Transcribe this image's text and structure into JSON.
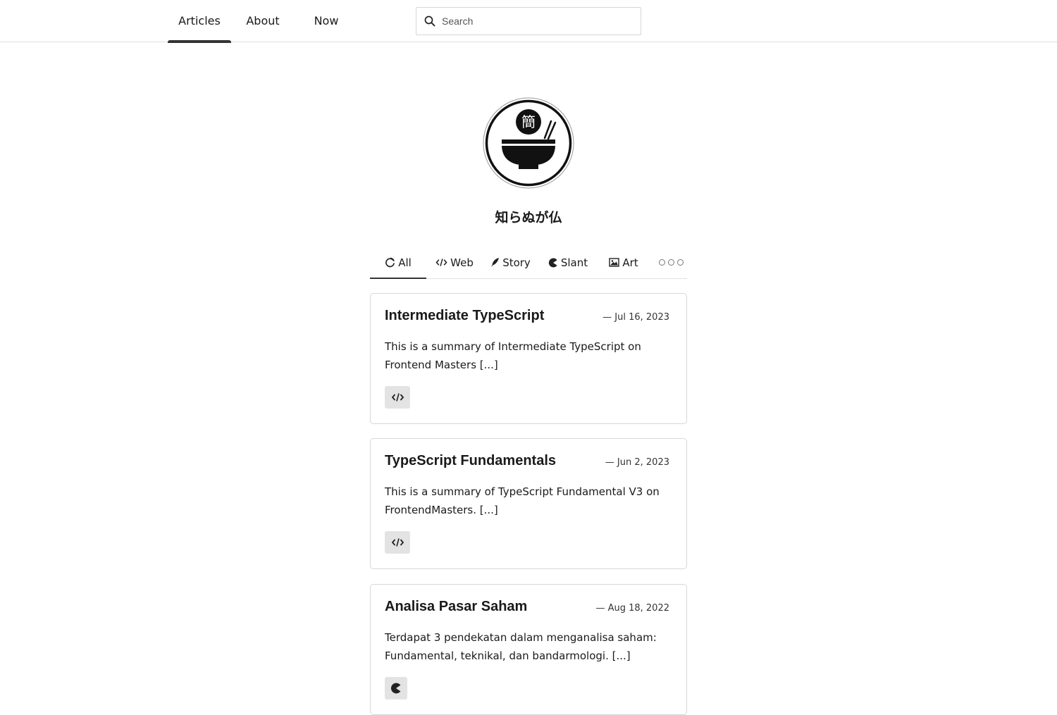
{
  "nav": {
    "tabs": [
      {
        "label": "Articles",
        "active": true
      },
      {
        "label": "About",
        "active": false
      },
      {
        "label": "Now",
        "active": false
      }
    ],
    "search_placeholder": "Search"
  },
  "profile": {
    "avatar_glyph": "簡",
    "title": "知らぬが仏"
  },
  "categories": {
    "tabs": [
      {
        "label": "All",
        "icon": "refresh-icon",
        "active": true
      },
      {
        "label": "Web",
        "icon": "code-icon",
        "active": false
      },
      {
        "label": "Story",
        "icon": "feather-icon",
        "active": false
      },
      {
        "label": "Slant",
        "icon": "pacman-icon",
        "active": false
      },
      {
        "label": "Art",
        "icon": "image-icon",
        "active": false
      }
    ],
    "more_icon": "more-dots-icon"
  },
  "articles": [
    {
      "title": "Intermediate TypeScript",
      "date": "— Jul 16, 2023",
      "summary": "This is a summary of Intermediate TypeScript on Frontend Masters [...]",
      "tag_icon": "code-icon"
    },
    {
      "title": "TypeScript Fundamentals",
      "date": "— Jun 2, 2023",
      "summary": "This is a summary of TypeScript Fundamental V3 on FrontendMasters. [...]",
      "tag_icon": "code-icon"
    },
    {
      "title": "Analisa Pasar Saham",
      "date": "— Aug 18, 2022",
      "summary": "Terdapat 3 pendekatan dalam menganalisa saham: Fundamental, teknikal, dan bandarmologi. [...]",
      "tag_icon": "pacman-icon"
    }
  ],
  "colors": {
    "text": "#1a1a1a",
    "border": "#d8d8d8",
    "tag_bg": "#e3e3e3",
    "accent": "#333333"
  }
}
